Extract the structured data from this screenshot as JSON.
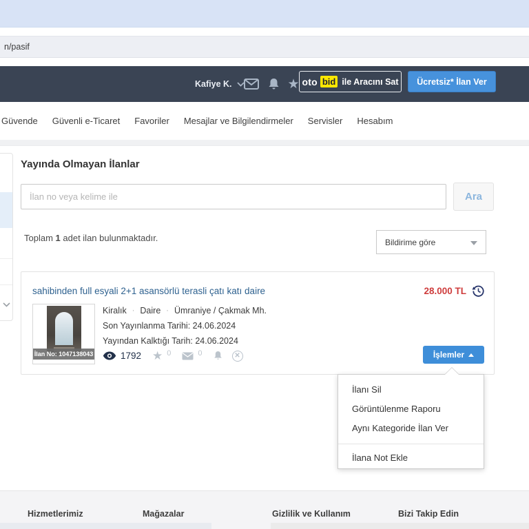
{
  "browser": {
    "url_fragment": "n/pasif"
  },
  "header": {
    "user_name": "Kafiye K.",
    "otobid": {
      "oto": "oto",
      "bid": "bid",
      "rest": "ile Aracını Sat"
    },
    "post_ad_button": "Ücretsiz* İlan Ver"
  },
  "nav": {
    "items": [
      "Güvende",
      "Güvenli e-Ticaret",
      "Favoriler",
      "Mesajlar ve Bilgilendirmeler",
      "Servisler",
      "Hesabım"
    ]
  },
  "page": {
    "title": "Yayında Olmayan İlanlar",
    "search_placeholder": "İlan no veya kelime ile",
    "search_button": "Ara",
    "result": {
      "prefix": "Toplam ",
      "count": "1",
      "suffix": " adet ilan bulunmaktadır."
    },
    "sort_dropdown_value": "Bildirime göre"
  },
  "listing": {
    "title": "sahibinden full esyali 2+1 asansörlü terasli çatı katı daire",
    "price": "28.000 TL",
    "ilan_no_badge": "İlan No: 1047138043",
    "category": "Kiralık",
    "property_type": "Daire",
    "location": "Ümraniye / Çakmak Mh.",
    "last_published": "Son Yayınlanma Tarihi: 24.06.2024",
    "removed_date": "Yayından Kalktığı Tarih: 24.06.2024",
    "views": "1792",
    "favorites": "0",
    "messages": "0",
    "actions_button": "İşlemler"
  },
  "actions_menu": {
    "items": [
      "İlanı Sil",
      "Görüntülenme Raporu",
      "Aynı Kategoride İlan Ver"
    ],
    "note_item": "İlana Not Ekle"
  },
  "footer": {
    "columns": [
      "Hizmetlerimiz",
      "Mağazalar",
      "Gizlilik ve Kullanım",
      "Bizi Takip Edin"
    ]
  },
  "colors": {
    "header_bg": "#3a4454",
    "accent_blue": "#4792dc",
    "price_red": "#ce3c3c",
    "bid_yellow": "#ffe800",
    "selected_item_bg": "#e4eef9"
  }
}
